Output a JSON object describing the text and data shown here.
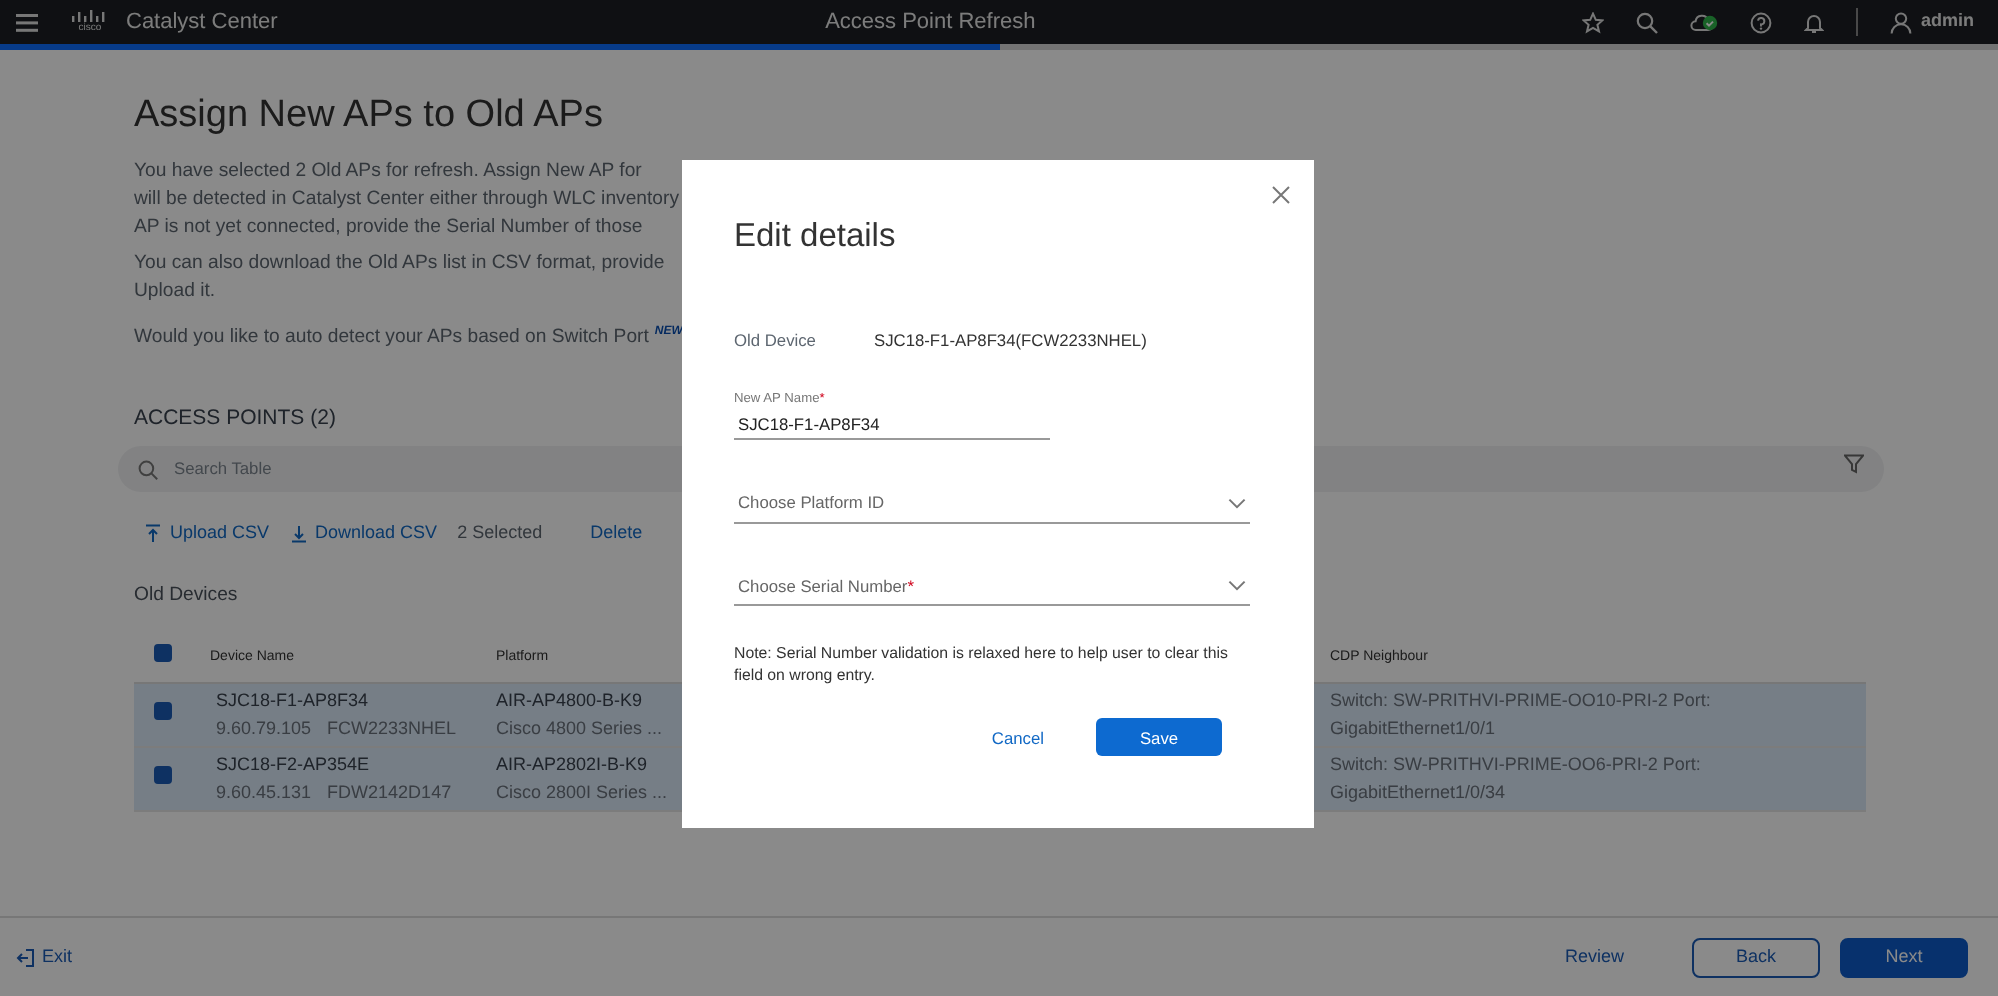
{
  "header": {
    "logo_text": "cisco",
    "title": "Catalyst Center",
    "page_title": "Access Point Refresh",
    "user": "admin"
  },
  "progress": {
    "level": 0.5
  },
  "intro": {
    "heading": "Assign New APs to Old APs",
    "lines": [
      "You have selected 2 Old APs for refresh. Assign New AP for",
      "will be detected in Catalyst Center either through WLC inventory",
      "AP is not yet connected, provide the Serial Number of those"
    ],
    "lines_2": [
      "You can also download the Old APs list in CSV format, provide",
      "Upload it."
    ],
    "question": "Would you like to auto detect your APs based on Switch Port",
    "new_badge": "NEW"
  },
  "access_points": {
    "title": "ACCESS POINTS (2)",
    "search": {
      "placeholder": "Search Table"
    },
    "actions": [
      {
        "kind": "upload",
        "label": "Upload CSV"
      },
      {
        "kind": "download",
        "label": "Download CSV"
      }
    ],
    "selected_count": "2 Selected",
    "delete": "Delete",
    "section": "Old Devices",
    "select_all_checked": true,
    "columns": [
      "Device Name",
      "Platform",
      "CDP Neighbour"
    ],
    "rows": [
      {
        "name": "SJC18-F1-AP8F34",
        "ip": "9.60.79.105",
        "serial": "FCW2233NHEL",
        "platform": "AIR-AP4800-B-K9",
        "series": "Cisco 4800 Series ...",
        "cdp": "Switch: SW-PRITHVI-PRIME-OO10-PRI-2 Port: GigabitEthernet1/0/1",
        "selected": true
      },
      {
        "name": "SJC18-F2-AP354E",
        "ip": "9.60.45.131",
        "serial": "FDW2142D147",
        "platform": "AIR-AP2802I-B-K9",
        "series": "Cisco 2800I Series ...",
        "cdp": "Switch: SW-PRITHVI-PRIME-OO6-PRI-2 Port: GigabitEthernet1/0/34",
        "selected": true
      }
    ]
  },
  "footer": {
    "exit": "Exit",
    "review": "Review",
    "back": "Back",
    "next": "Next"
  },
  "modal": {
    "title": "Edit details",
    "old_device_label": "Old Device",
    "old_device_value": "SJC18-F1-AP8F34(FCW2233NHEL)",
    "fields": [
      {
        "kind": "text",
        "label": "New AP Name",
        "required_mark": "*",
        "value": "SJC18-F1-AP8F34"
      },
      {
        "kind": "select",
        "placeholder": "Choose Platform ID"
      },
      {
        "kind": "select",
        "placeholder": "Choose Serial Number",
        "required_mark": "*"
      }
    ],
    "note": "Note: Serial Number validation is relaxed here to help user to clear this field on wrong entry.",
    "cancel": "Cancel",
    "save": "Save"
  }
}
